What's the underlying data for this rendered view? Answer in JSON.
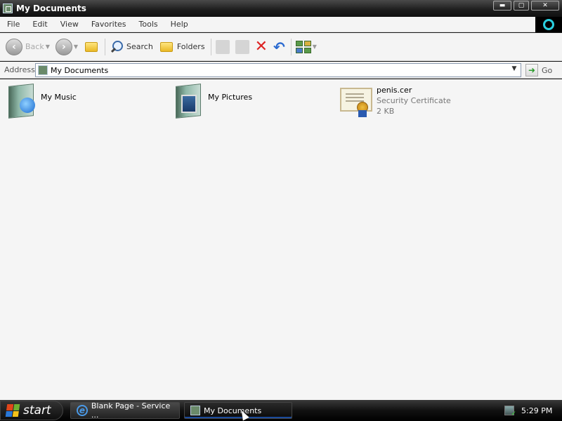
{
  "window": {
    "title": "My Documents",
    "controls": {
      "minimize": "▬",
      "maximize": "▢",
      "close": "✕"
    }
  },
  "menu": {
    "items": [
      "File",
      "Edit",
      "View",
      "Favorites",
      "Tools",
      "Help"
    ]
  },
  "toolbar": {
    "back_label": "Back",
    "search_label": "Search",
    "folders_label": "Folders"
  },
  "address": {
    "label": "Address",
    "value": "My Documents",
    "go_label": "Go"
  },
  "files": [
    {
      "name": "My Music",
      "type": "",
      "size": "",
      "icon": "music-folder-icon"
    },
    {
      "name": "My Pictures",
      "type": "",
      "size": "",
      "icon": "pictures-folder-icon"
    },
    {
      "name": "penis.cer",
      "type": "Security Certificate",
      "size": "2 KB",
      "icon": "certificate-icon"
    }
  ],
  "taskbar": {
    "start_label": "start",
    "tasks": [
      {
        "label": "Blank Page - Service ...",
        "icon": "ie-icon"
      },
      {
        "label": "My Documents",
        "icon": "my-documents-icon"
      }
    ],
    "clock": "5:29 PM"
  }
}
